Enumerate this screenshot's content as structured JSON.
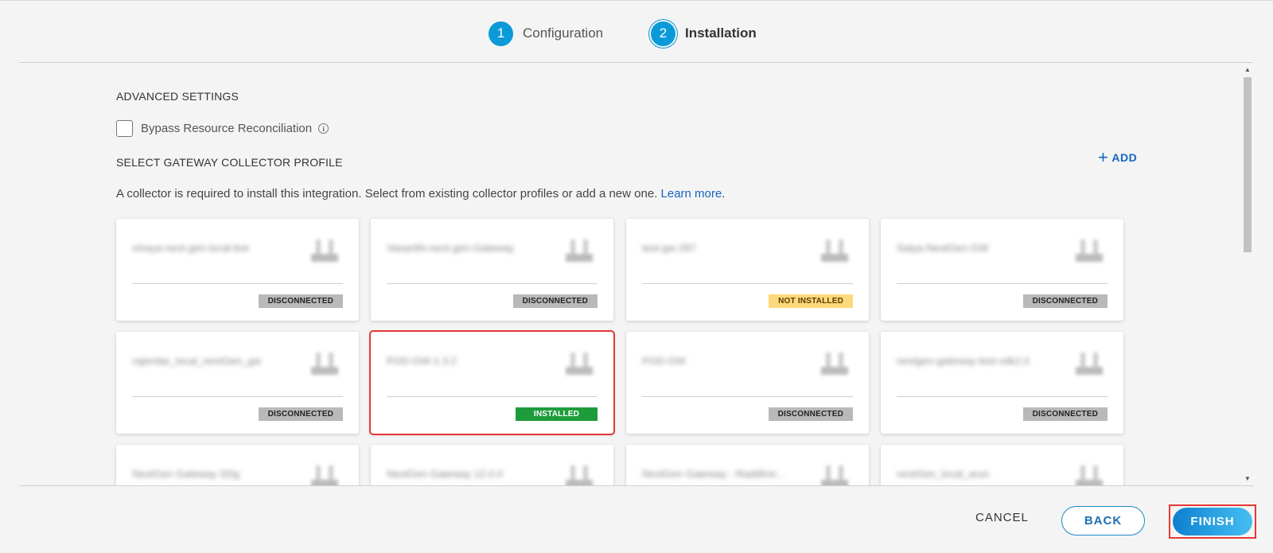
{
  "stepper": {
    "steps": [
      {
        "number": "1",
        "label": "Configuration"
      },
      {
        "number": "2",
        "label": "Installation"
      }
    ]
  },
  "advanced": {
    "title": "ADVANCED SETTINGS",
    "checkbox_label": "Bypass Resource Reconciliation",
    "checkbox_checked": false,
    "info_glyph": "i"
  },
  "gateway": {
    "title": "SELECT GATEWAY COLLECTOR PROFILE",
    "add_label": "ADD",
    "add_icon": "+",
    "description": "A collector is required to install this integration. Select from existing collector profiles or add a new one.",
    "learn_more": "Learn more",
    "description_end": ".",
    "cards": [
      {
        "name": "vinaya-next-gen-local-live",
        "status": "DISCONNECTED",
        "status_type": "disconnected"
      },
      {
        "name": "Vasanthi-next-gen-Gateway",
        "status": "DISCONNECTED",
        "status_type": "disconnected"
      },
      {
        "name": "test-gw-287",
        "status": "NOT INSTALLED",
        "status_type": "not-installed"
      },
      {
        "name": "Satya-NextGen-GW",
        "status": "DISCONNECTED",
        "status_type": "disconnected"
      },
      {
        "name": "rajendar_local_nextGen_gw",
        "status": "DISCONNECTED",
        "status_type": "disconnected"
      },
      {
        "name": "POD-GW-1.3.2",
        "status": "INSTALLED",
        "status_type": "installed",
        "selected": true
      },
      {
        "name": "POD-GW",
        "status": "DISCONNECTED",
        "status_type": "disconnected"
      },
      {
        "name": "nextgen-gateway-test-vdk2.0",
        "status": "DISCONNECTED",
        "status_type": "disconnected"
      },
      {
        "name": "NextGen Gateway 32tg",
        "status": "",
        "status_type": ""
      },
      {
        "name": "NextGen Gateway 12.0.0",
        "status": "",
        "status_type": ""
      },
      {
        "name": "NextGen Gateway - RaddKer...",
        "status": "",
        "status_type": ""
      },
      {
        "name": "nextGen_local_arun",
        "status": "",
        "status_type": ""
      }
    ]
  },
  "scrollbar": {
    "up_glyph": "▲",
    "down_glyph": "▼"
  },
  "footer": {
    "cancel_label": "CANCEL",
    "back_label": "BACK",
    "finish_label": "FINISH"
  },
  "colors": {
    "accent": "#0b9ad8",
    "link": "#1565c0",
    "installed": "#1e9c3c",
    "not_installed": "#fcd97a",
    "disconnected": "#b9b9b9",
    "highlight": "#e53935"
  }
}
